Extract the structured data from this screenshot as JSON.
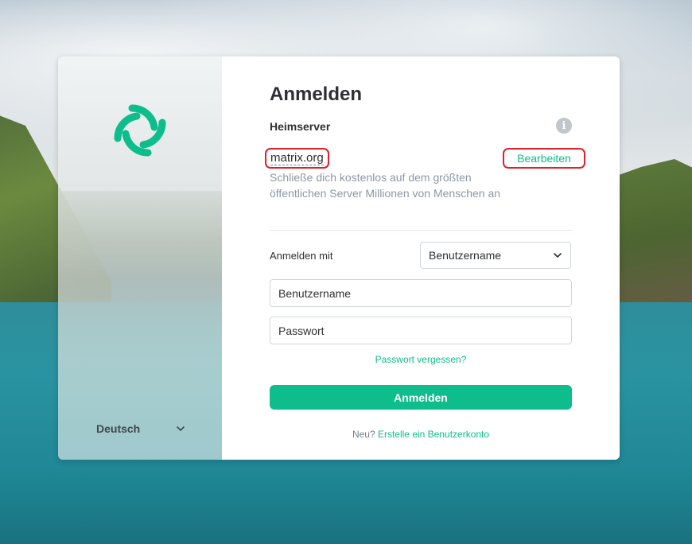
{
  "colors": {
    "accent": "#0dbd8b",
    "highlight_border": "#e0202a",
    "text_primary": "#2e2f32",
    "text_secondary": "#8d97a5"
  },
  "sidebar": {
    "logo_icon": "element-logo-icon",
    "language": {
      "label": "Deutsch",
      "icon": "chevron-down-icon"
    }
  },
  "login": {
    "title": "Anmelden",
    "homeserver_label": "Heimserver",
    "info_icon": "info-icon",
    "server_name": "matrix.org",
    "edit_label": "Bearbeiten",
    "server_description": "Schließe dich kostenlos auf dem größten öffentlichen Server Millionen von Menschen an",
    "signin_with_label": "Anmelden mit",
    "signin_with_selected": "Benutzername",
    "username_placeholder": "Benutzername",
    "password_placeholder": "Passwort",
    "forgot_password": "Passwort vergessen?",
    "submit_label": "Anmelden",
    "create_prompt": "Neu?",
    "create_link": "Erstelle ein Benutzerkonto"
  }
}
